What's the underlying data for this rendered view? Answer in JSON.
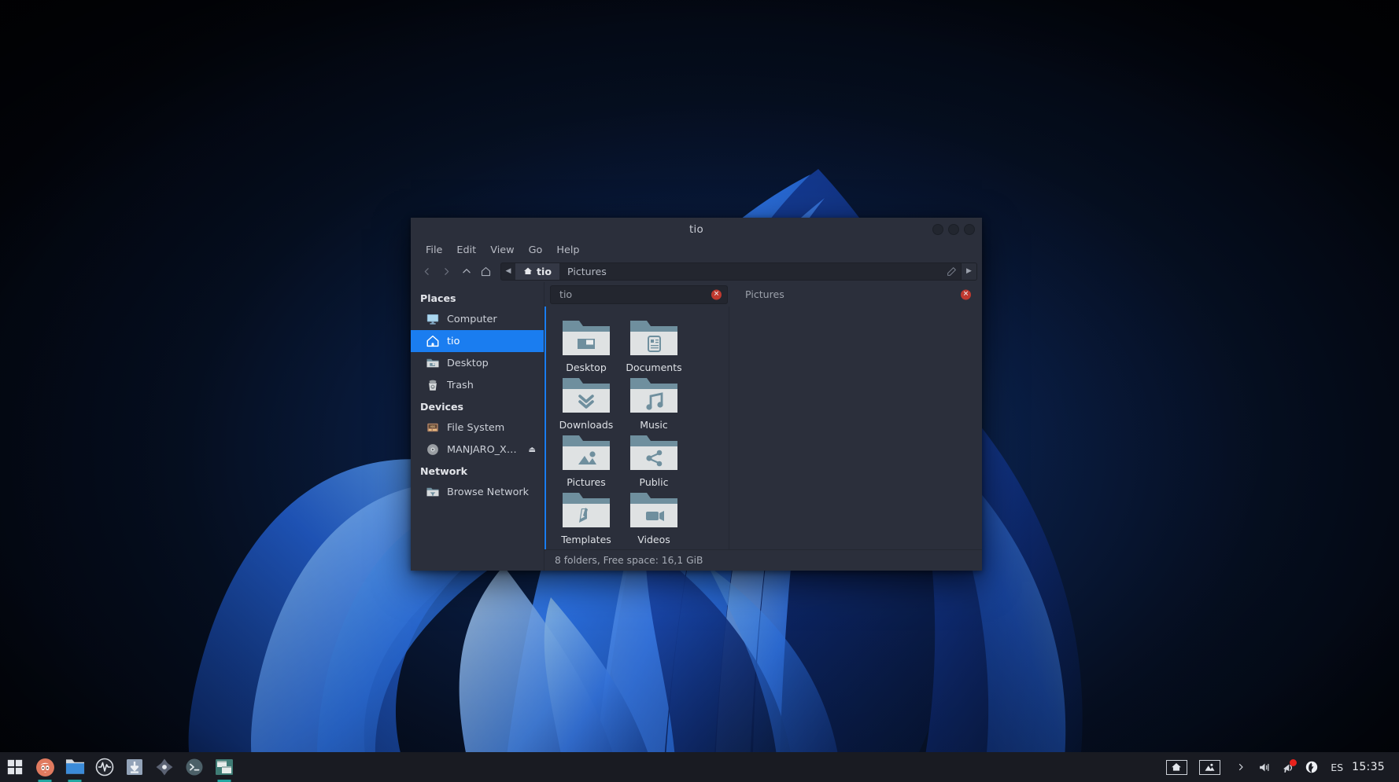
{
  "desktop": {
    "wallpaper_name": "windows-11-bloom-blue",
    "bg_colors": {
      "deep": "#03060f",
      "mid": "#0a1f47",
      "glow": "#123a7a",
      "ribbon_bright": "#3b8bff",
      "ribbon_light": "#7fc0ff",
      "ribbon_dark": "#0d2a72"
    }
  },
  "window": {
    "title": "tio",
    "accent": "#1a7df0",
    "controls": [
      {
        "name": "minimize"
      },
      {
        "name": "maximize"
      },
      {
        "name": "close"
      }
    ],
    "menu": [
      "File",
      "Edit",
      "View",
      "Go",
      "Help"
    ],
    "toolbar": {
      "back": "back-icon",
      "forward": "forward-icon",
      "up": "up-icon",
      "home": "home-icon",
      "path_prev": "path-scroll-left",
      "path_next": "path-scroll-right",
      "edit_path": "pencil-icon",
      "breadcrumbs": [
        {
          "label": "tio",
          "icon": "home-icon",
          "active": true
        },
        {
          "label": "Pictures",
          "icon": "",
          "active": false
        }
      ]
    },
    "sidebar": {
      "groups": [
        {
          "title": "Places",
          "items": [
            {
              "label": "Computer",
              "icon": "computer-icon",
              "selected": false,
              "eject": false
            },
            {
              "label": "tio",
              "icon": "home-icon",
              "selected": true,
              "eject": false
            },
            {
              "label": "Desktop",
              "icon": "desktop-folder-icon",
              "selected": false,
              "eject": false
            },
            {
              "label": "Trash",
              "icon": "trash-icon",
              "selected": false,
              "eject": false
            }
          ]
        },
        {
          "title": "Devices",
          "items": [
            {
              "label": "File System",
              "icon": "harddisk-icon",
              "selected": false,
              "eject": false
            },
            {
              "label": "MANJARO_XFCE...",
              "icon": "optical-disc-icon",
              "selected": false,
              "eject": true
            }
          ]
        },
        {
          "title": "Network",
          "items": [
            {
              "label": "Browse Network",
              "icon": "network-folder-icon",
              "selected": false,
              "eject": false
            }
          ]
        }
      ]
    },
    "panes": [
      {
        "id": "left",
        "filter_value": "tio",
        "filter_clear": "clear-icon",
        "focused": true,
        "items": [
          {
            "label": "Desktop",
            "icon": "folder-desktop-icon"
          },
          {
            "label": "Documents",
            "icon": "folder-documents-icon"
          },
          {
            "label": "Downloads",
            "icon": "folder-downloads-icon"
          },
          {
            "label": "Music",
            "icon": "folder-music-icon"
          },
          {
            "label": "Pictures",
            "icon": "folder-pictures-icon"
          },
          {
            "label": "Public",
            "icon": "folder-public-icon"
          },
          {
            "label": "Templates",
            "icon": "folder-templates-icon"
          },
          {
            "label": "Videos",
            "icon": "folder-videos-icon"
          }
        ]
      },
      {
        "id": "right",
        "filter_value": "Pictures",
        "filter_clear": "clear-icon",
        "focused": false,
        "items": []
      }
    ],
    "statusbar": "8 folders, Free space: 16,1 GiB"
  },
  "taskbar": {
    "launchers": [
      {
        "name": "app-grid",
        "icon": "grid-icon",
        "running": false
      },
      {
        "name": "firefox",
        "icon": "firefox-icon",
        "running": true
      },
      {
        "name": "file-manager",
        "icon": "folder-icon",
        "running": true
      },
      {
        "name": "system-monitor",
        "icon": "pulse-icon",
        "running": false
      },
      {
        "name": "downloader",
        "icon": "download-icon",
        "running": false
      },
      {
        "name": "settings",
        "icon": "diamond-icon",
        "running": false
      },
      {
        "name": "terminal",
        "icon": "terminal-icon",
        "running": false
      },
      {
        "name": "thunar-window",
        "icon": "windows-icon",
        "running": true
      }
    ],
    "workspaces": [
      {
        "name": "workspace-home",
        "icon": "home-icon"
      },
      {
        "name": "workspace-image",
        "icon": "image-icon"
      }
    ],
    "tray": [
      {
        "name": "tray-expand",
        "icon": "chevron-right-icon",
        "badge": false
      },
      {
        "name": "volume",
        "icon": "speaker-icon",
        "badge": false
      },
      {
        "name": "notifications",
        "icon": "bell-mute-icon",
        "badge": true
      },
      {
        "name": "power",
        "icon": "power-icon",
        "badge": false
      }
    ],
    "keyboard_layout": "ES",
    "clock": "15:35"
  }
}
